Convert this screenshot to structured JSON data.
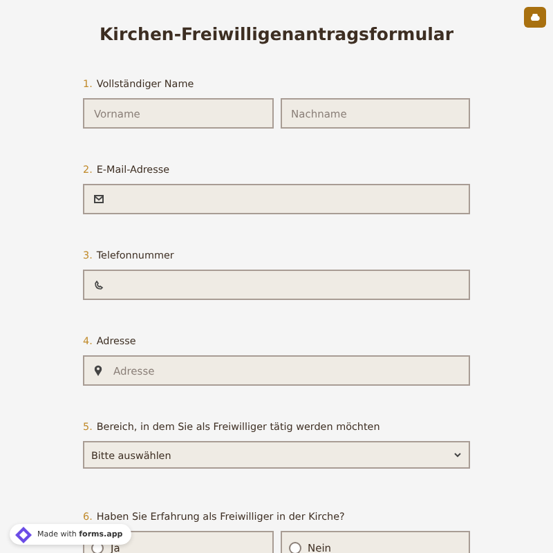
{
  "title": "Kirchen-Freiwilligenantragsformular",
  "questions": [
    {
      "number": "1.",
      "label": "Vollständiger Name",
      "kind": "name",
      "fields": [
        {
          "placeholder": "Vorname"
        },
        {
          "placeholder": "Nachname"
        }
      ]
    },
    {
      "number": "2.",
      "label": "E-Mail-Adresse",
      "kind": "email"
    },
    {
      "number": "3.",
      "label": "Telefonnummer",
      "kind": "phone"
    },
    {
      "number": "4.",
      "label": "Adresse",
      "kind": "address",
      "fields": [
        {
          "placeholder": "Adresse"
        }
      ]
    },
    {
      "number": "5.",
      "label": "Bereich, in dem Sie als Freiwilliger tätig werden möchten",
      "kind": "select",
      "value": "Bitte auswählen"
    },
    {
      "number": "6.",
      "label": "Haben Sie Erfahrung als Freiwilliger in der Kirche?",
      "kind": "radio",
      "options": [
        {
          "label": "Ja",
          "selected": false
        },
        {
          "label": "Nein",
          "selected": false
        }
      ]
    }
  ],
  "badge": "Made with **forms.app**"
}
